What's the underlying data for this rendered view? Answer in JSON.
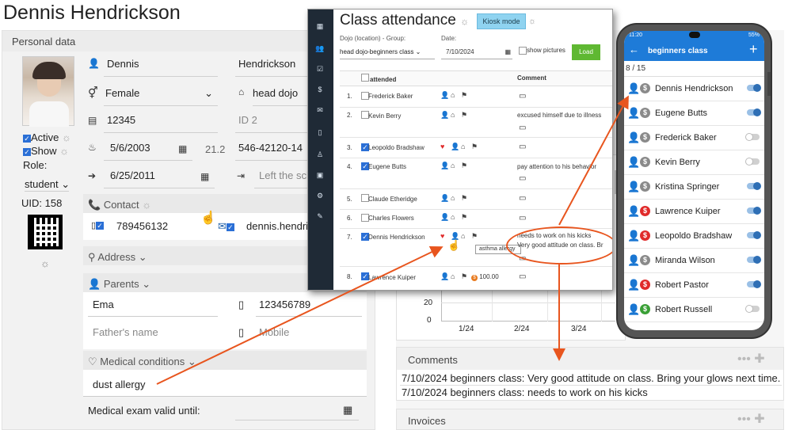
{
  "page_title": "Dennis Hendrickson",
  "personal": {
    "header": "Personal data",
    "first_name": "Dennis",
    "last_name": "Hendrickson",
    "gender": "Female",
    "dojo": "head dojo",
    "id_number": "12345",
    "id2_placeholder": "ID 2",
    "birth_date": "5/6/2003",
    "age": "21.2",
    "phone_code": "546-42120-14",
    "join_date": "6/25/2011",
    "left_placeholder": "Left the sch",
    "active_label": "Active",
    "show_label": "Show",
    "role_label": "Role:",
    "role_value": "student",
    "uid": "UID: 158",
    "contact_label": "Contact",
    "contact_phone": "789456132",
    "contact_email": "dennis.hendri",
    "address_label": "Address",
    "parents_label": "Parents",
    "parent_name": "Ema",
    "parent_phone": "123456789",
    "father_placeholder": "Father's name",
    "mobile_placeholder": "Mobile",
    "medical_label": "Medical conditions",
    "medical_value": "dust allergy",
    "exam_label": "Medical exam valid until:"
  },
  "attendance": {
    "title": "Class attendance",
    "kiosk": "Kiosk mode",
    "dojo_label": "Dojo (location) - Group:",
    "dojo_value": "head dojo-beginners class",
    "date_label": "Date:",
    "date_value": "7/10/2024",
    "show_pictures": "show pictures",
    "load": "Load",
    "col_attended": "attended",
    "col_comment": "Comment",
    "tooltip": "asthma allergy",
    "rows": [
      {
        "n": "1.",
        "name": "Frederick Baker",
        "checked": false,
        "comment": "",
        "comment2": ""
      },
      {
        "n": "2.",
        "name": "Kevin Berry",
        "checked": false,
        "comment": "excused himself due to illness",
        "comment2": ""
      },
      {
        "n": "3.",
        "name": "Leopoldo Bradshaw",
        "checked": true,
        "comment": "",
        "comment2": ""
      },
      {
        "n": "4.",
        "name": "Eugene Butts",
        "checked": true,
        "comment": "pay attention to his behavior",
        "comment2": ""
      },
      {
        "n": "5.",
        "name": "Claude Etheridge",
        "checked": false,
        "comment": "",
        "comment2": ""
      },
      {
        "n": "6.",
        "name": "Charles Flowers",
        "checked": false,
        "comment": "",
        "comment2": ""
      },
      {
        "n": "7.",
        "name": "Dennis Hendrickson",
        "checked": true,
        "comment": "needs to work on his kicks",
        "comment2": "Very good attitude on class. Br"
      },
      {
        "n": "8.",
        "name": "Lawrence Kuiper",
        "checked": true,
        "comment": "",
        "comment2": "",
        "amount": "100.00"
      }
    ]
  },
  "chart_area": {
    "y_ticks": [
      "20",
      "0"
    ],
    "x_ticks": [
      "1/24",
      "2/24",
      "3/24"
    ]
  },
  "comments": {
    "label": "Comments",
    "items": [
      "7/10/2024 beginners class: Very good attitude on class. Bring your glows next time.",
      "7/10/2024 beginners class: needs to work on his kicks"
    ]
  },
  "invoices": {
    "label": "Invoices"
  },
  "phone": {
    "time": "11:20",
    "battery": "55%",
    "header": "beginners class",
    "count": "8 / 15",
    "students": [
      {
        "name": "Dennis Hendrickson",
        "dollar": "gray",
        "on": true
      },
      {
        "name": "Eugene Butts",
        "dollar": "gray",
        "on": true
      },
      {
        "name": "Frederick Baker",
        "dollar": "gray",
        "on": false
      },
      {
        "name": "Kevin Berry",
        "dollar": "gray",
        "on": false
      },
      {
        "name": "Kristina Springer",
        "dollar": "gray",
        "on": true
      },
      {
        "name": "Lawrence Kuiper",
        "dollar": "red",
        "on": true
      },
      {
        "name": "Leopoldo Bradshaw",
        "dollar": "red",
        "on": true
      },
      {
        "name": "Miranda Wilson",
        "dollar": "gray",
        "on": true
      },
      {
        "name": "Robert Pastor",
        "dollar": "red",
        "on": true
      },
      {
        "name": "Robert Russell",
        "dollar": "green",
        "on": false
      }
    ]
  },
  "colors": {
    "accent": "#1e7bd8",
    "arrow": "#e8551e",
    "kiosk": "#8fd3f0",
    "load": "#5fb832"
  }
}
